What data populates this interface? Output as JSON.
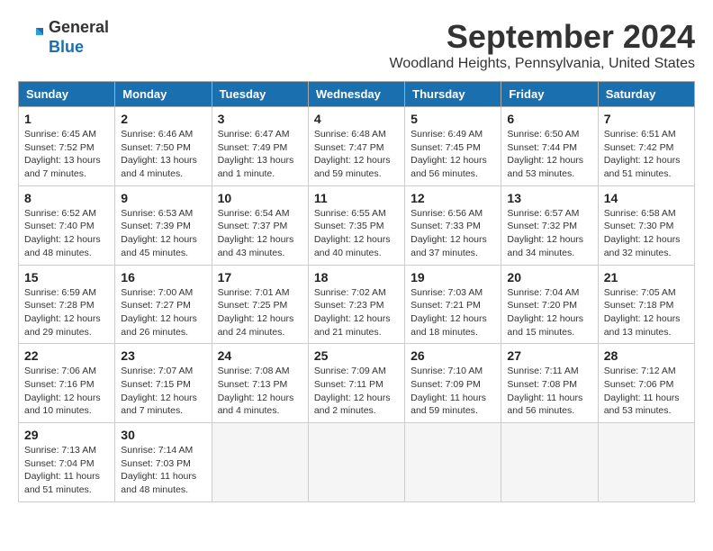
{
  "logo": {
    "general": "General",
    "blue": "Blue"
  },
  "title": "September 2024",
  "location": "Woodland Heights, Pennsylvania, United States",
  "weekdays": [
    "Sunday",
    "Monday",
    "Tuesday",
    "Wednesday",
    "Thursday",
    "Friday",
    "Saturday"
  ],
  "weeks": [
    [
      {
        "day": "1",
        "info": "Sunrise: 6:45 AM\nSunset: 7:52 PM\nDaylight: 13 hours and 7 minutes."
      },
      {
        "day": "2",
        "info": "Sunrise: 6:46 AM\nSunset: 7:50 PM\nDaylight: 13 hours and 4 minutes."
      },
      {
        "day": "3",
        "info": "Sunrise: 6:47 AM\nSunset: 7:49 PM\nDaylight: 13 hours and 1 minute."
      },
      {
        "day": "4",
        "info": "Sunrise: 6:48 AM\nSunset: 7:47 PM\nDaylight: 12 hours and 59 minutes."
      },
      {
        "day": "5",
        "info": "Sunrise: 6:49 AM\nSunset: 7:45 PM\nDaylight: 12 hours and 56 minutes."
      },
      {
        "day": "6",
        "info": "Sunrise: 6:50 AM\nSunset: 7:44 PM\nDaylight: 12 hours and 53 minutes."
      },
      {
        "day": "7",
        "info": "Sunrise: 6:51 AM\nSunset: 7:42 PM\nDaylight: 12 hours and 51 minutes."
      }
    ],
    [
      {
        "day": "8",
        "info": "Sunrise: 6:52 AM\nSunset: 7:40 PM\nDaylight: 12 hours and 48 minutes."
      },
      {
        "day": "9",
        "info": "Sunrise: 6:53 AM\nSunset: 7:39 PM\nDaylight: 12 hours and 45 minutes."
      },
      {
        "day": "10",
        "info": "Sunrise: 6:54 AM\nSunset: 7:37 PM\nDaylight: 12 hours and 43 minutes."
      },
      {
        "day": "11",
        "info": "Sunrise: 6:55 AM\nSunset: 7:35 PM\nDaylight: 12 hours and 40 minutes."
      },
      {
        "day": "12",
        "info": "Sunrise: 6:56 AM\nSunset: 7:33 PM\nDaylight: 12 hours and 37 minutes."
      },
      {
        "day": "13",
        "info": "Sunrise: 6:57 AM\nSunset: 7:32 PM\nDaylight: 12 hours and 34 minutes."
      },
      {
        "day": "14",
        "info": "Sunrise: 6:58 AM\nSunset: 7:30 PM\nDaylight: 12 hours and 32 minutes."
      }
    ],
    [
      {
        "day": "15",
        "info": "Sunrise: 6:59 AM\nSunset: 7:28 PM\nDaylight: 12 hours and 29 minutes."
      },
      {
        "day": "16",
        "info": "Sunrise: 7:00 AM\nSunset: 7:27 PM\nDaylight: 12 hours and 26 minutes."
      },
      {
        "day": "17",
        "info": "Sunrise: 7:01 AM\nSunset: 7:25 PM\nDaylight: 12 hours and 24 minutes."
      },
      {
        "day": "18",
        "info": "Sunrise: 7:02 AM\nSunset: 7:23 PM\nDaylight: 12 hours and 21 minutes."
      },
      {
        "day": "19",
        "info": "Sunrise: 7:03 AM\nSunset: 7:21 PM\nDaylight: 12 hours and 18 minutes."
      },
      {
        "day": "20",
        "info": "Sunrise: 7:04 AM\nSunset: 7:20 PM\nDaylight: 12 hours and 15 minutes."
      },
      {
        "day": "21",
        "info": "Sunrise: 7:05 AM\nSunset: 7:18 PM\nDaylight: 12 hours and 13 minutes."
      }
    ],
    [
      {
        "day": "22",
        "info": "Sunrise: 7:06 AM\nSunset: 7:16 PM\nDaylight: 12 hours and 10 minutes."
      },
      {
        "day": "23",
        "info": "Sunrise: 7:07 AM\nSunset: 7:15 PM\nDaylight: 12 hours and 7 minutes."
      },
      {
        "day": "24",
        "info": "Sunrise: 7:08 AM\nSunset: 7:13 PM\nDaylight: 12 hours and 4 minutes."
      },
      {
        "day": "25",
        "info": "Sunrise: 7:09 AM\nSunset: 7:11 PM\nDaylight: 12 hours and 2 minutes."
      },
      {
        "day": "26",
        "info": "Sunrise: 7:10 AM\nSunset: 7:09 PM\nDaylight: 11 hours and 59 minutes."
      },
      {
        "day": "27",
        "info": "Sunrise: 7:11 AM\nSunset: 7:08 PM\nDaylight: 11 hours and 56 minutes."
      },
      {
        "day": "28",
        "info": "Sunrise: 7:12 AM\nSunset: 7:06 PM\nDaylight: 11 hours and 53 minutes."
      }
    ],
    [
      {
        "day": "29",
        "info": "Sunrise: 7:13 AM\nSunset: 7:04 PM\nDaylight: 11 hours and 51 minutes."
      },
      {
        "day": "30",
        "info": "Sunrise: 7:14 AM\nSunset: 7:03 PM\nDaylight: 11 hours and 48 minutes."
      },
      {
        "day": "",
        "info": ""
      },
      {
        "day": "",
        "info": ""
      },
      {
        "day": "",
        "info": ""
      },
      {
        "day": "",
        "info": ""
      },
      {
        "day": "",
        "info": ""
      }
    ]
  ]
}
